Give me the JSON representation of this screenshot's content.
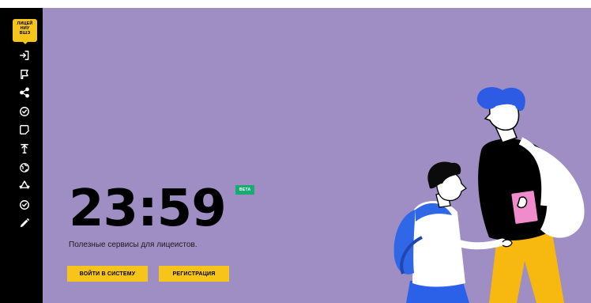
{
  "logo": {
    "lines": [
      "ЛИЦЕЙ",
      "НИУ",
      "ВШЭ"
    ]
  },
  "sidebar": {
    "items": [
      {
        "icon": "login-icon"
      },
      {
        "icon": "flag-icon"
      },
      {
        "icon": "share-icon"
      },
      {
        "icon": "check-circle-icon"
      },
      {
        "icon": "edit-note-icon"
      },
      {
        "icon": "upload-icon"
      },
      {
        "icon": "globe-icon"
      },
      {
        "icon": "recycle-icon"
      },
      {
        "icon": "check-circle-icon"
      },
      {
        "icon": "pencil-icon"
      }
    ]
  },
  "hero": {
    "clock": "23:59",
    "badge": "BETA",
    "subtitle": "Полезные сервисы для лицеистов.",
    "login_label": "ВОЙТИ В СИСТЕМУ",
    "register_label": "РЕГИСТРАЦИЯ"
  },
  "colors": {
    "background": "#9f8ec4",
    "sidebar": "#000000",
    "accent": "#f7c41a",
    "badge": "#1aaa73"
  }
}
